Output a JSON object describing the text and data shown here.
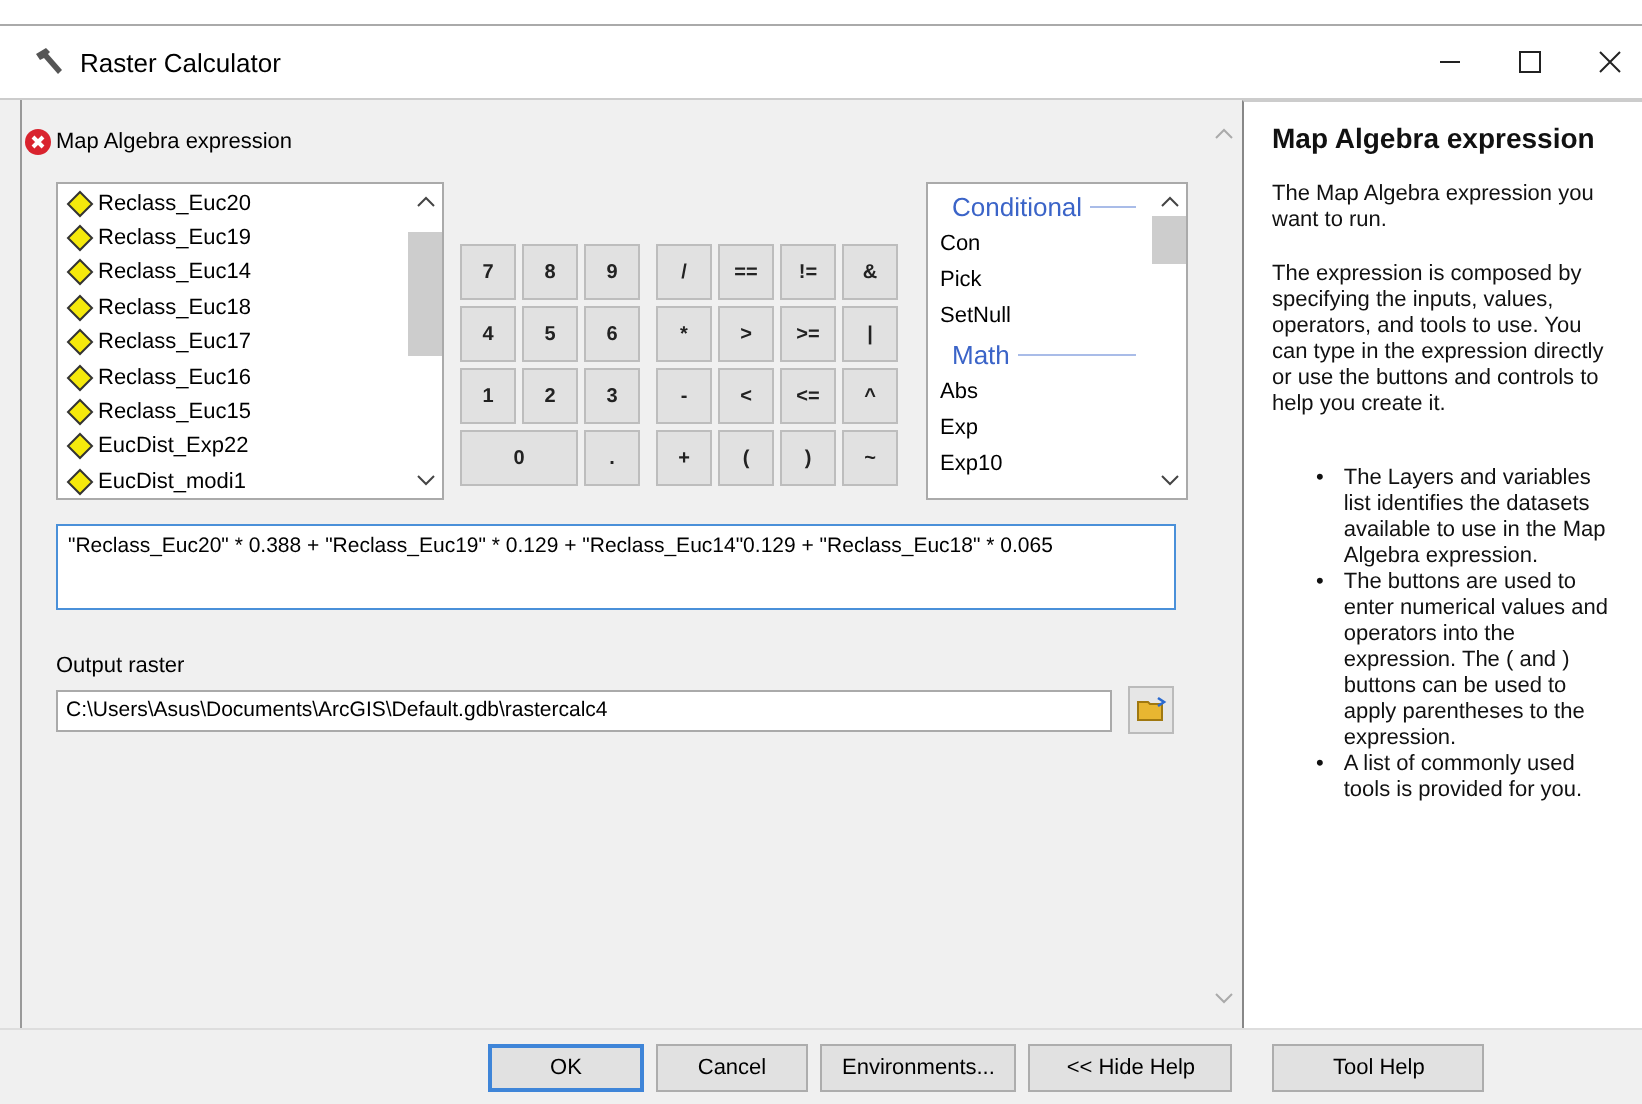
{
  "window": {
    "title": "Raster Calculator",
    "controls": [
      {
        "kind": "minimize"
      },
      {
        "kind": "maximize"
      },
      {
        "kind": "close"
      }
    ]
  },
  "parameter": {
    "label": "Map Algebra expression",
    "error": true
  },
  "layers": [
    "Reclass_Euc20",
    "Reclass_Euc19",
    "Reclass_Euc14",
    "Reclass_Euc18",
    "Reclass_Euc17",
    "Reclass_Euc16",
    "Reclass_Euc15",
    "EucDist_Exp22",
    "EucDist_modi1"
  ],
  "number_keys": [
    {
      "label": "7"
    },
    {
      "label": "8"
    },
    {
      "label": "9"
    },
    {
      "label": "4"
    },
    {
      "label": "5"
    },
    {
      "label": "6"
    },
    {
      "label": "1"
    },
    {
      "label": "2"
    },
    {
      "label": "3"
    },
    {
      "label": "0",
      "wide": true
    },
    {
      "label": "."
    }
  ],
  "operator_keys": [
    "/",
    "==",
    "!=",
    "&",
    "*",
    ">",
    ">=",
    "|",
    "-",
    "<",
    "<=",
    "^",
    "+",
    "(",
    ")",
    "~"
  ],
  "tools": [
    {
      "header": "Conditional",
      "items": [
        "Con",
        "Pick",
        "SetNull"
      ]
    },
    {
      "header": "Math",
      "items": [
        "Abs",
        "Exp",
        "Exp10"
      ]
    }
  ],
  "expression": "\"Reclass_Euc20\" * 0.388 + \"Reclass_Euc19\" * 0.129 + \"Reclass_Euc14\"0.129 + \"Reclass_Euc18\" * 0.065",
  "output": {
    "label": "Output raster",
    "value": "C:\\Users\\Asus\\Documents\\ArcGIS\\Default.gdb\\rastercalc4"
  },
  "help": {
    "title": "Map Algebra expression",
    "paragraphs": [
      "The Map Algebra expression you want to run.",
      "The expression is composed by specifying the inputs, values, operators, and tools to use. You can type in the expression directly or use the buttons and controls to help you create it."
    ],
    "bullet_marker": "•",
    "bullets": [
      "The Layers and variables list identifies the datasets available to use in the Map Algebra expression.",
      "The buttons are used to enter numerical values and operators into the expression. The ( and ) buttons can be used to apply parentheses to the expression.",
      "A list of commonly used tools is provided for you."
    ]
  },
  "buttons": [
    {
      "label": "OK",
      "default": true
    },
    {
      "label": "Cancel",
      "default": false
    },
    {
      "label": "Environments...",
      "default": false
    },
    {
      "label": "<< Hide Help",
      "default": false
    },
    {
      "label": "Tool Help",
      "default": false
    }
  ]
}
